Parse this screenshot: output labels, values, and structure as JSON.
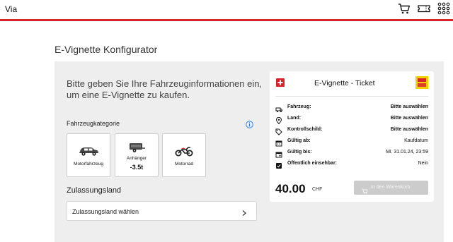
{
  "header": {
    "brand": "Via",
    "icons": [
      "cart-icon",
      "ticket-icon",
      "apps-grid-icon"
    ],
    "accent_color": "#d8232a"
  },
  "page": {
    "title": "E-Vignette Konfigurator"
  },
  "configurator": {
    "intro": "Bitte geben Sie Ihre Fahrzeuginformationen ein, um eine E-Vignette zu kaufen.",
    "category_label": "Fahrzeugkategorie",
    "categories": [
      {
        "label": "Motorfahrzeug",
        "icon": "car-icon"
      },
      {
        "label": "Anhänger",
        "sub": "-3.5t",
        "icon": "trailer-icon"
      },
      {
        "label": "Motorrad",
        "icon": "motorcycle-icon"
      }
    ],
    "country_label": "Zulassungsland",
    "country_placeholder": "Zulassungsland wählen"
  },
  "ticket": {
    "title": "E-Vignette - Ticket",
    "logo_color": "#f2d000",
    "rows": [
      {
        "label": "Fahrzeug:",
        "value": "Bitte auswählen",
        "icon": "vehicle-icon",
        "bold": true
      },
      {
        "label": "Land:",
        "value": "Bitte auswählen",
        "icon": "location-pin-icon",
        "bold": true
      },
      {
        "label": "Kontrollschild:",
        "value": "Bitte auswählen",
        "icon": "tag-icon",
        "bold": true
      },
      {
        "label": "Gültig ab:",
        "value": "Kaufdatum",
        "icon": "calendar-icon",
        "bold": false
      },
      {
        "label": "Gültig bis:",
        "value": "Mi. 31.01.24, 23:59",
        "icon": "calendar-end-icon",
        "bold": false
      },
      {
        "label": "Öffentlich einsehbar:",
        "value": "Nein",
        "icon": "checkbox-icon",
        "bold": false
      }
    ],
    "price": "40.00",
    "currency": "CHF",
    "cart_button": "In den Warenkorb"
  }
}
